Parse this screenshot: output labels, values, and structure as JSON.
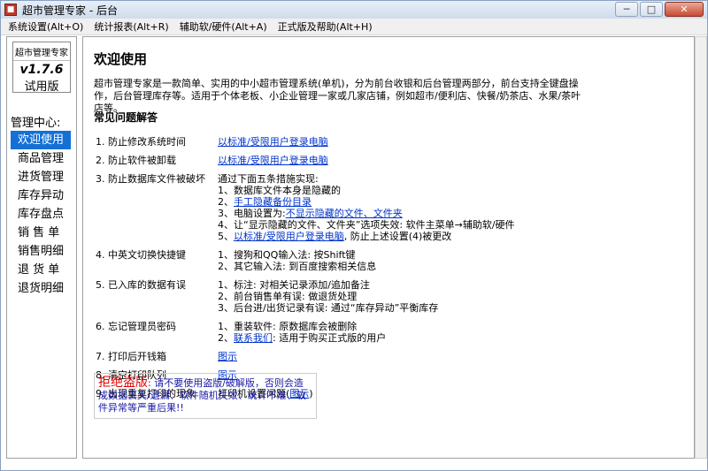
{
  "window": {
    "title": "超市管理专家 - 后台",
    "icon": "app-icon",
    "buttons": {
      "minimize": "─",
      "maximize": "□",
      "close": "✕"
    }
  },
  "menu": [
    "系统设置(Alt+O)",
    "统计报表(Alt+R)",
    "辅助软/硬件(Alt+A)",
    "正式版及帮助(Alt+H)"
  ],
  "sidebar": {
    "product": "超市管理专家",
    "version": "v1.7.6",
    "edition": "试用版",
    "mgmt_title": "管理中心:",
    "items": [
      "欢迎使用",
      "商品管理",
      "进货管理",
      "库存异动",
      "库存盘点",
      "销 售 单",
      "销售明细",
      "退 货 单",
      "退货明细"
    ],
    "active_index": 0
  },
  "content": {
    "title": "欢迎使用",
    "intro": "超市管理专家是一款简单、实用的中小超市管理系统(单机)，分为前台收银和后台管理两部分，前台支持全键盘操作，后台管理库存等。适用于个体老板、小企业管理一家或几家店铺，例如超市/便利店、快餐/奶茶店、水果/茶叶店等。",
    "faq_heading": "常见问题解答",
    "faq": [
      {
        "q": "1. 防止修改系统时间",
        "a": [
          {
            "link": "以标准/受限用户登录电脑"
          }
        ]
      },
      {
        "q": "2. 防止软件被卸载",
        "a": [
          {
            "link": "以标准/受限用户登录电脑"
          }
        ]
      },
      {
        "q": "3. 防止数据库文件被破坏",
        "a": [
          {
            "text": "通过下面五条措施实现:"
          },
          {
            "text": "1、数据库文件本身是隐藏的"
          },
          {
            "pre": "2、",
            "link": "手工隐藏备份目录"
          },
          {
            "pre": "3、电脑设置为:",
            "link": "不显示隐藏的文件、文件夹"
          },
          {
            "text": "4、让“显示隐藏的文件、文件夹”选项失效: 软件主菜单→辅助软/硬件"
          },
          {
            "pre": "5、",
            "link": "以标准/受限用户登录电脑",
            "post": ", 防止上述设置(4)被更改"
          }
        ]
      },
      {
        "q": "4. 中英文切换快捷键",
        "a": [
          {
            "text": "1、搜狗和QQ输入法: 按Shift键"
          },
          {
            "text": "2、其它输入法: 到百度搜索相关信息"
          }
        ]
      },
      {
        "q": "5. 已入库的数据有误",
        "a": [
          {
            "text": "1、标注: 对相关记录添加/追加备注"
          },
          {
            "text": "2、前台销售单有误: 做退货处理"
          },
          {
            "text": "3、后台进/出货记录有误: 通过“库存异动”平衡库存"
          }
        ]
      },
      {
        "q": "6. 忘记管理员密码",
        "a": [
          {
            "text": "1、重装软件: 原数据库会被删除"
          },
          {
            "pre": "2、",
            "link": "联系我们",
            "post": ": 适用于购买正式版的用户"
          }
        ]
      },
      {
        "q": "7. 打印后开钱箱",
        "a": [
          {
            "link": "图示"
          }
        ]
      },
      {
        "q": "8. 清空打印队列",
        "a": [
          {
            "link": "图示"
          }
        ]
      },
      {
        "q": "9. 出现重复打印的现象",
        "a": [
          {
            "pre": "打印机设置问题(",
            "link": "图示",
            "post": ")"
          }
        ]
      }
    ],
    "warning_title": "拒绝盗版",
    "warning_text": ": 请不要使用盗版/破解版，否则会造成数据丢失/遗漏、软件随机失效、统计不准、软件异常等严重后果!!"
  }
}
